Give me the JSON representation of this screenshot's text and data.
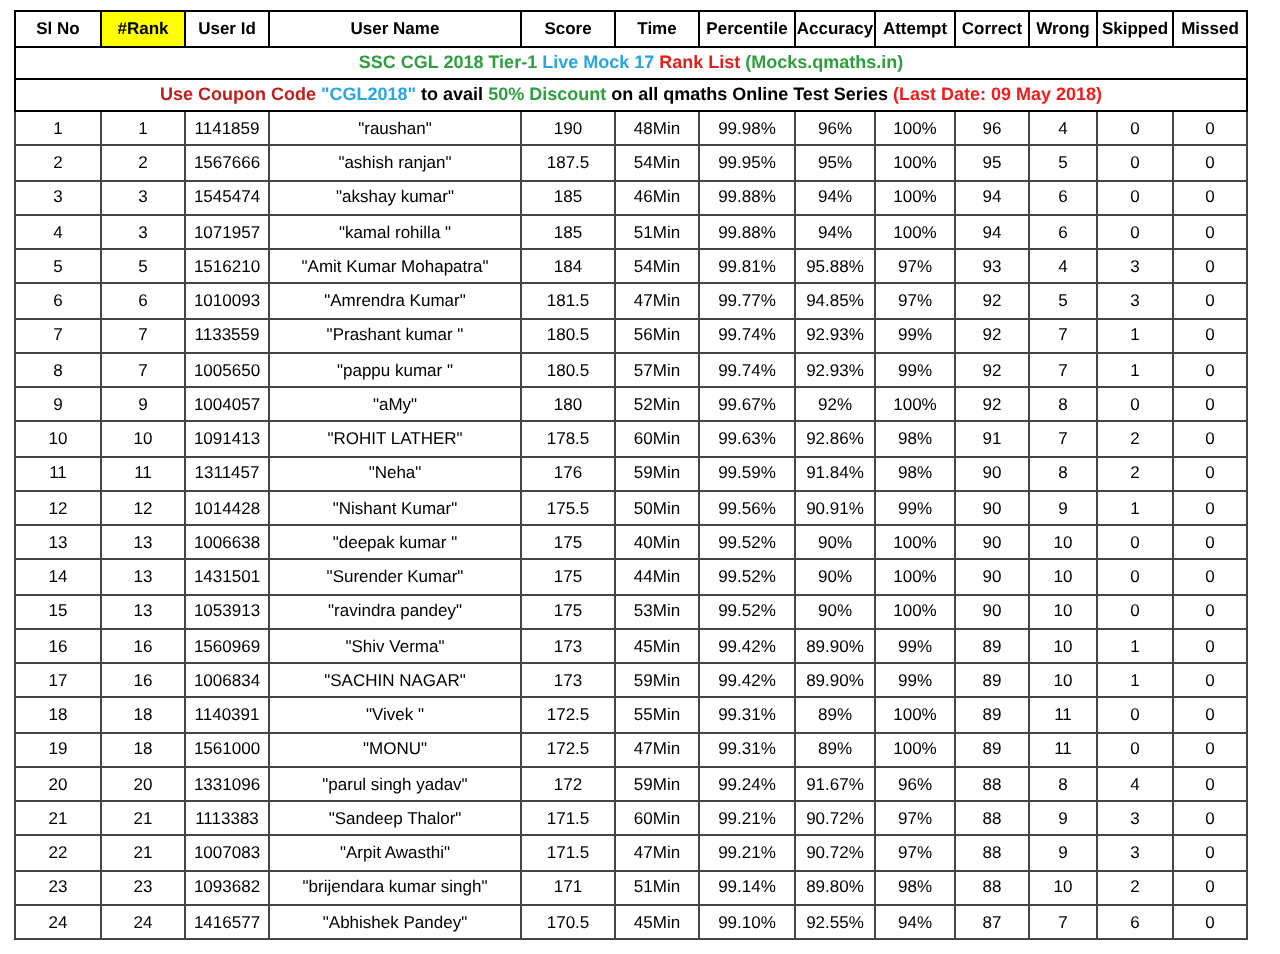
{
  "columns": [
    {
      "label": "Sl No",
      "highlighted": false
    },
    {
      "label": "#Rank",
      "highlighted": true
    },
    {
      "label": "User Id",
      "highlighted": false
    },
    {
      "label": "User Name",
      "highlighted": false
    },
    {
      "label": "Score",
      "highlighted": false
    },
    {
      "label": "Time",
      "highlighted": false
    },
    {
      "label": "Percentile",
      "highlighted": false
    },
    {
      "label": "Accuracy",
      "highlighted": false
    },
    {
      "label": "Attempt",
      "highlighted": false
    },
    {
      "label": "Correct",
      "highlighted": false
    },
    {
      "label": "Wrong",
      "highlighted": false
    },
    {
      "label": "Skipped",
      "highlighted": false
    },
    {
      "label": "Missed",
      "highlighted": false
    }
  ],
  "banners": [
    {
      "segments": [
        {
          "text": "SSC CGL 2018 Tier-1",
          "color": "#2e9e3e"
        },
        {
          "text": "Live Mock 17",
          "color": "#2aa6e0"
        },
        {
          "text": "Rank List",
          "color": "#e0201c"
        },
        {
          "text": "(Mocks.qmaths.in)",
          "color": "#2e9e3e"
        }
      ]
    },
    {
      "segments": [
        {
          "text": "Use Coupon Code",
          "color": "#c0201c"
        },
        {
          "text": "\"CGL2018\"",
          "color": "#2aa6e0"
        },
        {
          "text": "to avail",
          "color": "#000000"
        },
        {
          "text": "50% Discount",
          "color": "#2e9e3e"
        },
        {
          "text": "on all qmaths Online Test Series",
          "color": "#000000"
        },
        {
          "text": "(Last Date: 09 May 2018)",
          "color": "#f01c1c"
        }
      ]
    }
  ],
  "rows": [
    [
      "1",
      "1",
      "1141859",
      "\"raushan\"",
      "190",
      "48Min",
      "99.98%",
      "96%",
      "100%",
      "96",
      "4",
      "0",
      "0"
    ],
    [
      "2",
      "2",
      "1567666",
      "\"ashish ranjan\"",
      "187.5",
      "54Min",
      "99.95%",
      "95%",
      "100%",
      "95",
      "5",
      "0",
      "0"
    ],
    [
      "3",
      "3",
      "1545474",
      "\"akshay kumar\"",
      "185",
      "46Min",
      "99.88%",
      "94%",
      "100%",
      "94",
      "6",
      "0",
      "0"
    ],
    [
      "4",
      "3",
      "1071957",
      "\"kamal rohilla \"",
      "185",
      "51Min",
      "99.88%",
      "94%",
      "100%",
      "94",
      "6",
      "0",
      "0"
    ],
    [
      "5",
      "5",
      "1516210",
      "\"Amit Kumar Mohapatra\"",
      "184",
      "54Min",
      "99.81%",
      "95.88%",
      "97%",
      "93",
      "4",
      "3",
      "0"
    ],
    [
      "6",
      "6",
      "1010093",
      "\"Amrendra Kumar\"",
      "181.5",
      "47Min",
      "99.77%",
      "94.85%",
      "97%",
      "92",
      "5",
      "3",
      "0"
    ],
    [
      "7",
      "7",
      "1133559",
      "\"Prashant kumar \"",
      "180.5",
      "56Min",
      "99.74%",
      "92.93%",
      "99%",
      "92",
      "7",
      "1",
      "0"
    ],
    [
      "8",
      "7",
      "1005650",
      "\"pappu kumar \"",
      "180.5",
      "57Min",
      "99.74%",
      "92.93%",
      "99%",
      "92",
      "7",
      "1",
      "0"
    ],
    [
      "9",
      "9",
      "1004057",
      "\"aMy\"",
      "180",
      "52Min",
      "99.67%",
      "92%",
      "100%",
      "92",
      "8",
      "0",
      "0"
    ],
    [
      "10",
      "10",
      "1091413",
      "\"ROHIT LATHER\"",
      "178.5",
      "60Min",
      "99.63%",
      "92.86%",
      "98%",
      "91",
      "7",
      "2",
      "0"
    ],
    [
      "11",
      "11",
      "1311457",
      "\"Neha\"",
      "176",
      "59Min",
      "99.59%",
      "91.84%",
      "98%",
      "90",
      "8",
      "2",
      "0"
    ],
    [
      "12",
      "12",
      "1014428",
      "\"Nishant Kumar\"",
      "175.5",
      "50Min",
      "99.56%",
      "90.91%",
      "99%",
      "90",
      "9",
      "1",
      "0"
    ],
    [
      "13",
      "13",
      "1006638",
      "\"deepak kumar \"",
      "175",
      "40Min",
      "99.52%",
      "90%",
      "100%",
      "90",
      "10",
      "0",
      "0"
    ],
    [
      "14",
      "13",
      "1431501",
      "\"Surender Kumar\"",
      "175",
      "44Min",
      "99.52%",
      "90%",
      "100%",
      "90",
      "10",
      "0",
      "0"
    ],
    [
      "15",
      "13",
      "1053913",
      "\"ravindra pandey\"",
      "175",
      "53Min",
      "99.52%",
      "90%",
      "100%",
      "90",
      "10",
      "0",
      "0"
    ],
    [
      "16",
      "16",
      "1560969",
      "\"Shiv Verma\"",
      "173",
      "45Min",
      "99.42%",
      "89.90%",
      "99%",
      "89",
      "10",
      "1",
      "0"
    ],
    [
      "17",
      "16",
      "1006834",
      "\"SACHIN NAGAR\"",
      "173",
      "59Min",
      "99.42%",
      "89.90%",
      "99%",
      "89",
      "10",
      "1",
      "0"
    ],
    [
      "18",
      "18",
      "1140391",
      "\"Vivek \"",
      "172.5",
      "55Min",
      "99.31%",
      "89%",
      "100%",
      "89",
      "11",
      "0",
      "0"
    ],
    [
      "19",
      "18",
      "1561000",
      "\"MONU\"",
      "172.5",
      "47Min",
      "99.31%",
      "89%",
      "100%",
      "89",
      "11",
      "0",
      "0"
    ],
    [
      "20",
      "20",
      "1331096",
      "\"parul singh yadav\"",
      "172",
      "59Min",
      "99.24%",
      "91.67%",
      "96%",
      "88",
      "8",
      "4",
      "0"
    ],
    [
      "21",
      "21",
      "1113383",
      "\"Sandeep Thalor\"",
      "171.5",
      "60Min",
      "99.21%",
      "90.72%",
      "97%",
      "88",
      "9",
      "3",
      "0"
    ],
    [
      "22",
      "21",
      "1007083",
      "\"Arpit Awasthi\"",
      "171.5",
      "47Min",
      "99.21%",
      "90.72%",
      "97%",
      "88",
      "9",
      "3",
      "0"
    ],
    [
      "23",
      "23",
      "1093682",
      "\"brijendara kumar singh\"",
      "171",
      "51Min",
      "99.14%",
      "89.80%",
      "98%",
      "88",
      "10",
      "2",
      "0"
    ],
    [
      "24",
      "24",
      "1416577",
      "\"Abhishek Pandey\"",
      "170.5",
      "45Min",
      "99.10%",
      "92.55%",
      "94%",
      "87",
      "7",
      "6",
      "0"
    ]
  ]
}
